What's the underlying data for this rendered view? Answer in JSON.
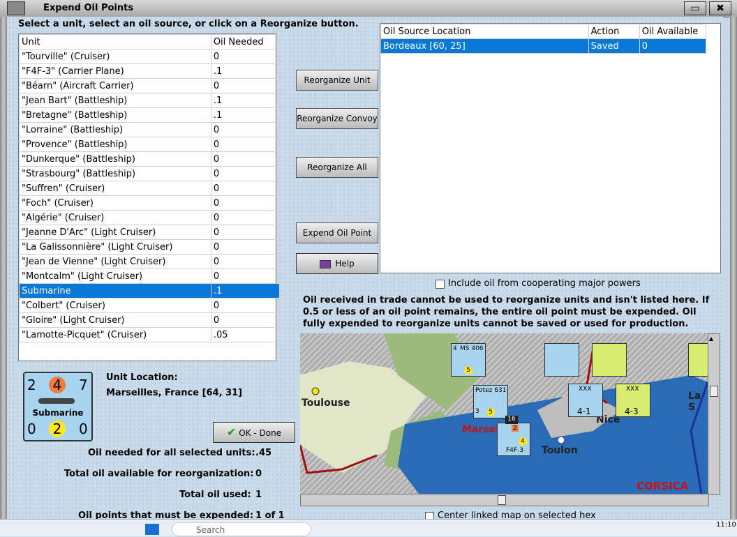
{
  "window": {
    "title": "Expend Oil Points",
    "close_glyph": "✖"
  },
  "instruction": "Select a unit, select an oil source, or click on a Reorganize button.",
  "units_table": {
    "headers": [
      "Unit",
      "Oil Needed"
    ],
    "rows": [
      [
        "\"Tourville\" (Cruiser)",
        "0"
      ],
      [
        "\"F4F-3\" (Carrier Plane)",
        ".1"
      ],
      [
        "\"Béarn\" (Aircraft Carrier)",
        "0"
      ],
      [
        "\"Jean Bart\" (Battleship)",
        ".1"
      ],
      [
        "\"Bretagne\" (Battleship)",
        ".1"
      ],
      [
        "\"Lorraine\" (Battleship)",
        "0"
      ],
      [
        "\"Provence\" (Battleship)",
        "0"
      ],
      [
        "\"Dunkerque\" (Battleship)",
        "0"
      ],
      [
        "\"Strasbourg\" (Battleship)",
        "0"
      ],
      [
        "\"Suffren\" (Cruiser)",
        "0"
      ],
      [
        "\"Foch\" (Cruiser)",
        "0"
      ],
      [
        "\"Algérie\" (Cruiser)",
        "0"
      ],
      [
        "\"Jeanne D'Arc\" (Light Cruiser)",
        "0"
      ],
      [
        "\"La Galissonnière\" (Light Cruiser)",
        "0"
      ],
      [
        "\"Jean de Vienne\" (Light Cruiser)",
        "0"
      ],
      [
        "\"Montcalm\" (Light Cruiser)",
        "0"
      ],
      [
        "Submarine",
        ".1"
      ],
      [
        "\"Colbert\" (Cruiser)",
        "0"
      ],
      [
        "\"Gloire\" (Light Cruiser)",
        "0"
      ],
      [
        "\"Lamotte-Picquet\" (Cruiser)",
        ".05"
      ]
    ],
    "selected_index": 16
  },
  "source_table": {
    "headers": [
      "Oil Source Location",
      "Action",
      "Oil Available"
    ],
    "rows": [
      [
        "Bordeaux [60, 25]",
        "Saved",
        "0"
      ]
    ],
    "selected_index": 0
  },
  "buttons": {
    "reorganize_unit": "Reorganize Unit",
    "reorganize_convoy": "Reorganize Convoy",
    "reorganize_all": "Reorganize All",
    "expend_oil_point": "Expend Oil Point",
    "help": "Help",
    "ok_done": "OK - Done"
  },
  "include_oil_label": "Include oil from cooperating major powers",
  "info_text": "Oil received in trade cannot be used to reorganize units and isn't listed here.  If 0.5 or less of an oil point remains, the entire oil point must be expended.   Oil fully expended to reorganize units cannot be saved or used for production.",
  "unit_counter": {
    "top_left": "2",
    "top_mid": "4",
    "top_right": "7",
    "name": "Submarine",
    "bottom_left": "0",
    "bottom_mid": "2",
    "bottom_right": "0"
  },
  "unit_location": {
    "label": "Unit Location:",
    "value": "Marseilles, France [64, 31]"
  },
  "summary": {
    "oil_needed_label": "Oil needed for all selected units:",
    "oil_needed_value": ".45",
    "total_available_label": "Total oil available for reorganization:",
    "total_available_value": "0",
    "total_used_label": "Total oil used:",
    "total_used_value": "1",
    "must_expend_label": "Oil points that must be expended:",
    "must_expend_value": "1 of 1"
  },
  "center_map_label": "Center linked map on selected hex",
  "map_labels": {
    "toulouse": "Toulouse",
    "marseille": "Marsei",
    "toulon": "Toulon",
    "nice": "Nice",
    "corsica": "CORSICA",
    "la_spezia": "La S"
  },
  "map_units": {
    "ms406": {
      "name": "MS 406",
      "left": "4",
      "mid": "5"
    },
    "potez": {
      "name": "Potez 631",
      "left": "3",
      "mid": "5"
    },
    "f4f3": {
      "name": "F4F-3",
      "mid": "4",
      "top": "2"
    },
    "corps1": {
      "size": "XXX",
      "val": "4-1"
    },
    "corps2": {
      "size": "XXX",
      "val": "4-3"
    },
    "stack": "16"
  },
  "taskbar": {
    "search_placeholder": "Search",
    "time": "11:10"
  },
  "colors": {
    "selection": "#0a78d7",
    "sea": "#2a6bb5",
    "counter": "#a8d4f0",
    "red_label": "#cc1111"
  }
}
